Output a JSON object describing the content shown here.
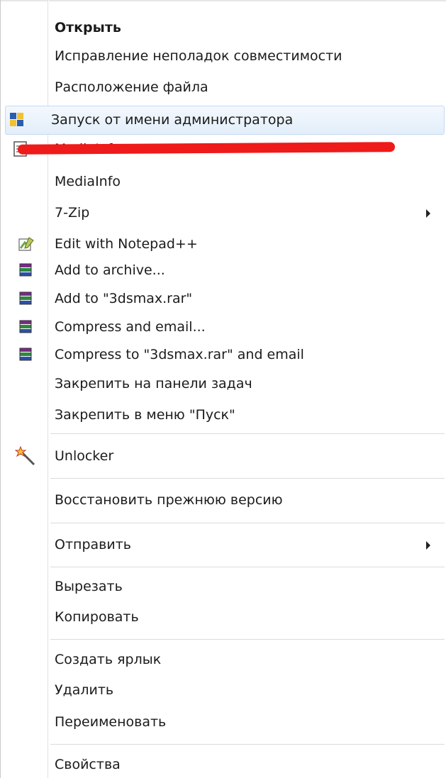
{
  "menu": {
    "items": [
      {
        "label": "Открыть"
      },
      {
        "label": "Исправление неполадок совместимости"
      },
      {
        "label": "Расположение файла"
      },
      {
        "label": "Запуск от имени администратора"
      },
      {
        "label": "MediaInfo"
      },
      {
        "label": "MediaInfo"
      },
      {
        "label": "7-Zip"
      },
      {
        "label": "Edit with Notepad++"
      },
      {
        "label": "Add to archive..."
      },
      {
        "label": "Add to \"3dsmax.rar\""
      },
      {
        "label": "Compress and email..."
      },
      {
        "label": "Compress to \"3dsmax.rar\" and email"
      },
      {
        "label": "Закрепить на панели задач"
      },
      {
        "label": "Закрепить в меню \"Пуск\""
      },
      {
        "label": "Unlocker"
      },
      {
        "label": "Восстановить прежнюю версию"
      },
      {
        "label": "Отправить"
      },
      {
        "label": "Вырезать"
      },
      {
        "label": "Копировать"
      },
      {
        "label": "Создать ярлык"
      },
      {
        "label": "Удалить"
      },
      {
        "label": "Переименовать"
      },
      {
        "label": "Свойства"
      }
    ]
  },
  "colors": {
    "highlight": "#e3eefa",
    "strike": "#ef1a1a"
  },
  "icons": [
    "uac-shield-icon",
    "mediainfo-icon",
    "notepadpp-icon",
    "winrar-icon",
    "unlocker-wand-icon",
    "submenu-arrow-icon"
  ]
}
